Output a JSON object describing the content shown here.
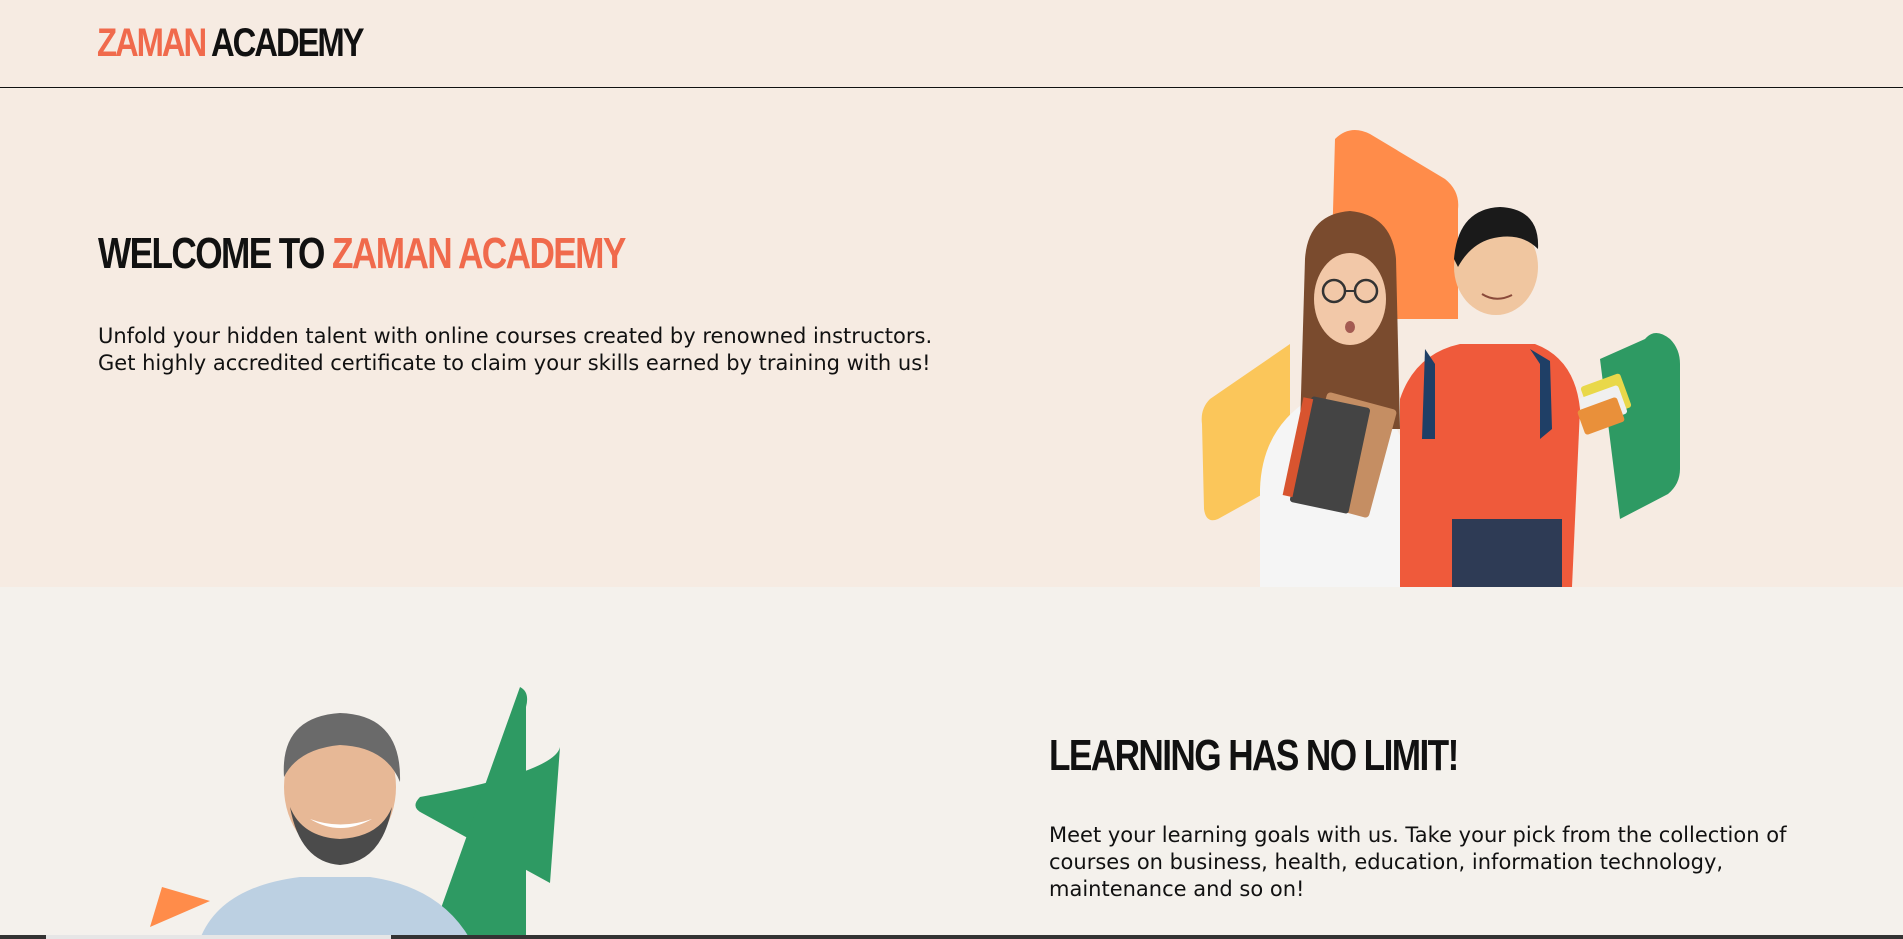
{
  "brand": {
    "part1": "ZAMAN",
    "part2": "ACADEMY"
  },
  "hero": {
    "title_prefix": "WELCOME TO",
    "title_accent": "ZAMAN ACADEMY",
    "body": "Unfold your hidden talent with online courses created by renowned instructors. Get highly accredited certificate to claim your skills earned by training with us!"
  },
  "section2": {
    "title": "LEARNING HAS NO LIMIT!",
    "body": "Meet your learning goals with us. Take your pick from the collection of courses on business, health, education, information technology, maintenance and so on!"
  },
  "colors": {
    "accent": "#f06a4c",
    "orange_shape": "#ff8c4a",
    "yellow_shape": "#fbc65a",
    "green_shape": "#2e9a63",
    "header_bg": "#f6ebe2",
    "section_bg": "#f4f1ec"
  }
}
